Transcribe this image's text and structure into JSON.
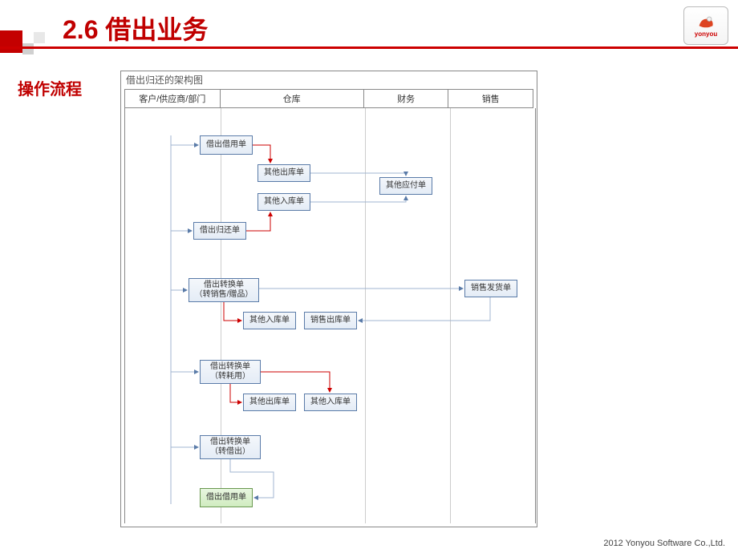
{
  "title": "2.6 借出业务",
  "subtitle": "操作流程",
  "logo_text": "yonyou",
  "footer": "2012 Yonyou Software Co.,Ltd.",
  "diagram": {
    "title": "借出归还的架构图",
    "columns": [
      "客户/供应商/部门",
      "仓库",
      "财务",
      "销售"
    ],
    "boxes": {
      "n1": "借出借用单",
      "n2": "其他出库单",
      "n3": "其他应付单",
      "n4": "其他入库单",
      "n5": "借出归还单",
      "n6": "借出转换单\n（转销售/赠品）",
      "n7": "其他入库单",
      "n8": "销售出库单",
      "n9": "销售发货单",
      "n10": "借出转换单\n（转耗用）",
      "n11": "其他出库单",
      "n12": "其他入库单",
      "n13": "借出转换单\n（转借出）",
      "n14": "借出借用单"
    }
  }
}
